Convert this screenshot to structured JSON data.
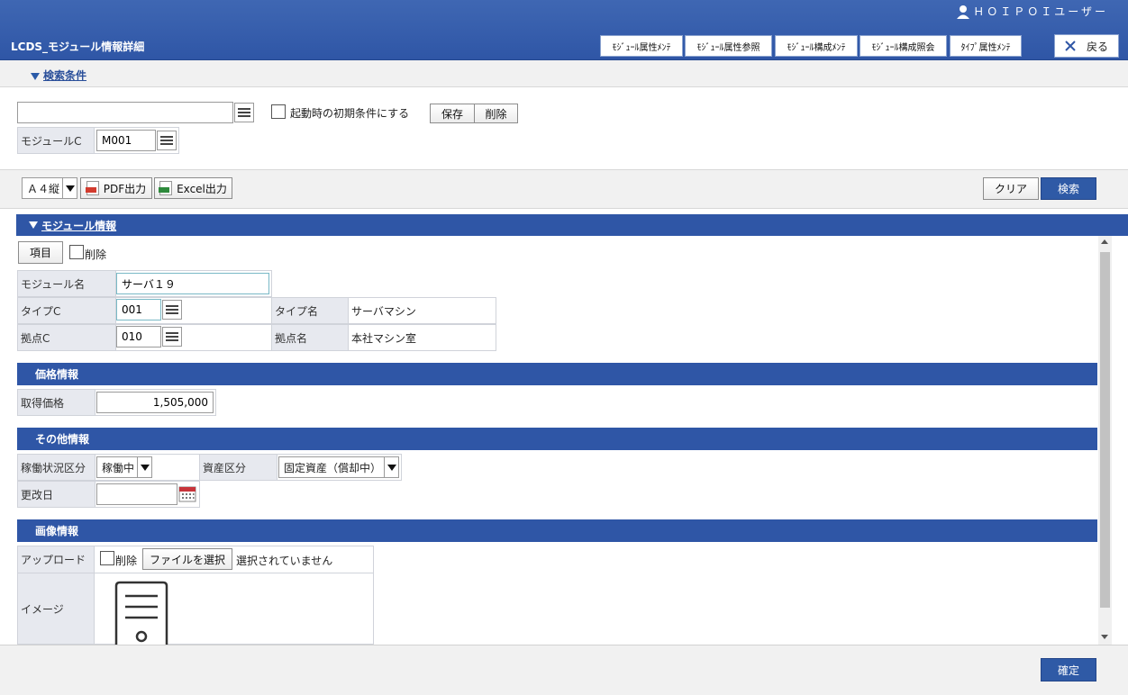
{
  "header": {
    "user_label": "ＨＯＩＰＯＩユーザー",
    "app_title": "LCDS_モジュール情報詳細",
    "nav_buttons": [
      "ﾓｼﾞｭｰﾙ属性ﾒﾝﾃ",
      "ﾓｼﾞｭｰﾙ属性参照",
      "ﾓｼﾞｭｰﾙ構成ﾒﾝﾃ",
      "ﾓｼﾞｭｰﾙ構成照会",
      "ﾀｲﾌﾟ属性ﾒﾝﾃ"
    ],
    "back_label": "戻る"
  },
  "search": {
    "section_label": "検索条件",
    "condition_value": "",
    "startup_label": "起動時の初期条件にする",
    "save_label": "保存",
    "delete_label": "削除",
    "module_c_label": "モジュールC",
    "module_c_value": "M001"
  },
  "toolbar": {
    "paper_value": "Ａ４縦",
    "pdf_label": "PDF出力",
    "excel_label": "Excel出力",
    "clear_label": "クリア",
    "search_label": "検索"
  },
  "module": {
    "section_label": "モジュール情報",
    "item_button": "項目",
    "delete_label": "削除",
    "name_label": "モジュール名",
    "name_value": "サーバ１９",
    "type_c_label": "タイプC",
    "type_c_value": "001",
    "type_name_label": "タイプ名",
    "type_name_value": "サーバマシン",
    "site_c_label": "拠点C",
    "site_c_value": "010",
    "site_name_label": "拠点名",
    "site_name_value": "本社マシン室"
  },
  "price": {
    "section_label": "価格情報",
    "acq_label": "取得価格",
    "acq_value": "1,505,000"
  },
  "other": {
    "section_label": "その他情報",
    "status_label": "稼働状況区分",
    "status_value": "稼働中",
    "asset_label": "資産区分",
    "asset_value": "固定資産（償却中）",
    "date_label": "更改日",
    "date_value": ""
  },
  "image": {
    "section_label": "画像情報",
    "upload_label": "アップロード",
    "delete_label": "削除",
    "file_button": "ファイルを選択",
    "file_status": "選択されていません",
    "image_label": "イメージ"
  },
  "footer": {
    "confirm_label": "確定"
  }
}
